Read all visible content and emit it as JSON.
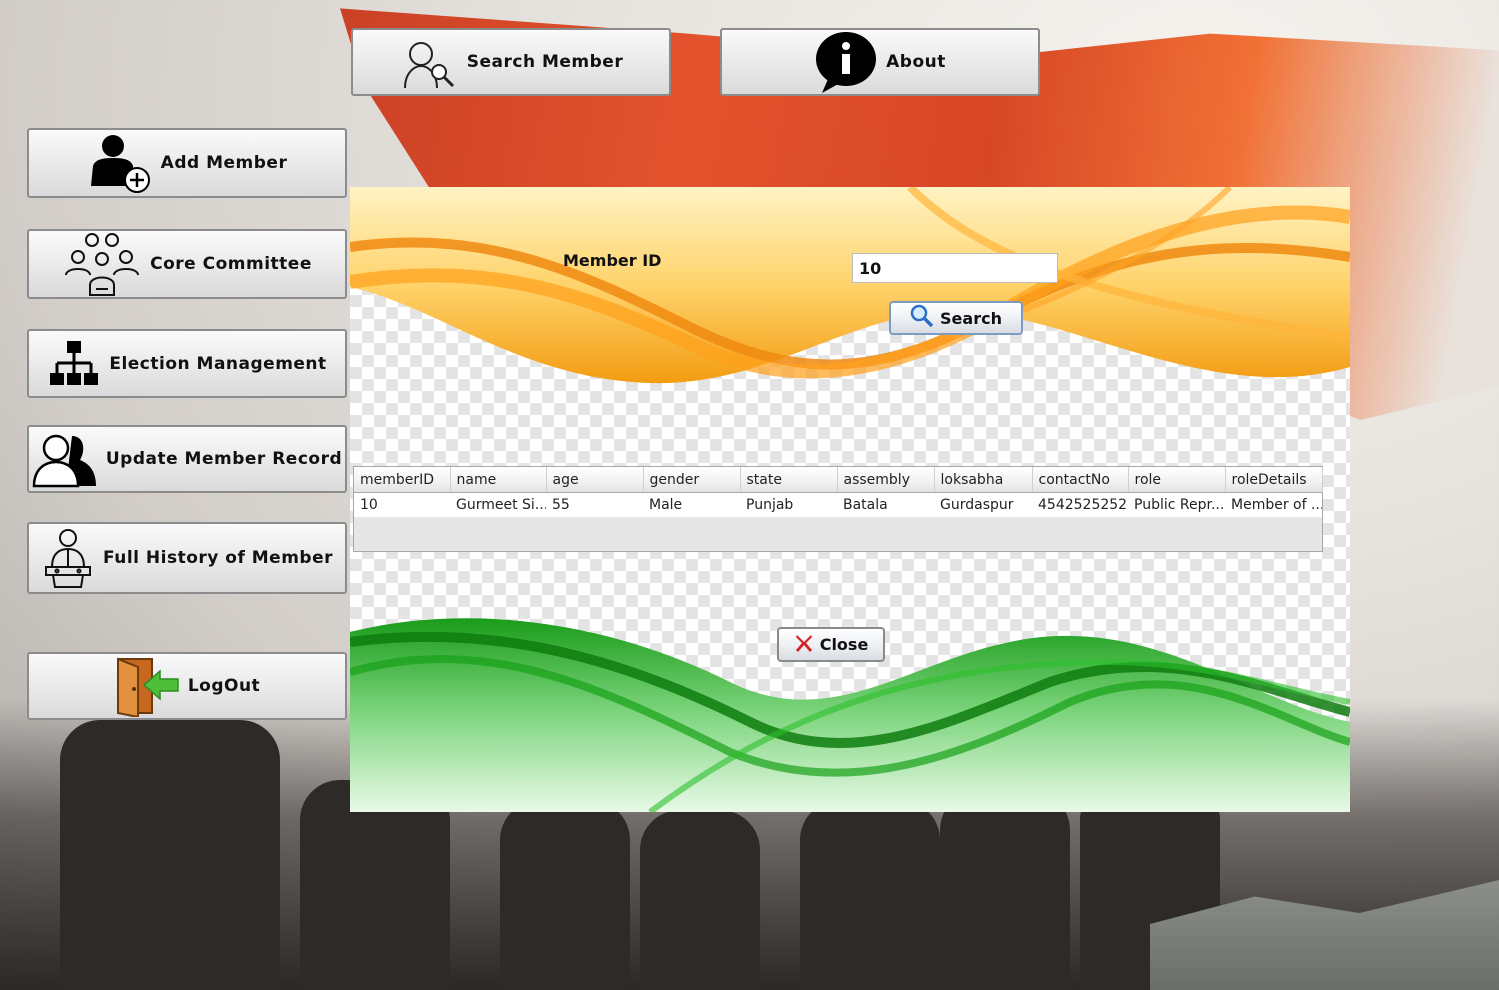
{
  "top_nav": {
    "search_member": "Search Member",
    "about": "About"
  },
  "sidebar": {
    "items": [
      {
        "label": "Add Member",
        "icon": "add-user-icon"
      },
      {
        "label": "Core Committee",
        "icon": "group-icon"
      },
      {
        "label": "Election Management",
        "icon": "hierarchy-icon"
      },
      {
        "label": "Update Member Record",
        "icon": "users-icon"
      },
      {
        "label": "Full History of Member",
        "icon": "speaker-icon"
      },
      {
        "label": "LogOut",
        "icon": "logout-door-icon"
      }
    ]
  },
  "form": {
    "member_id_label": "Member ID",
    "member_id_value": "10",
    "search_button": "Search",
    "close_button": "Close"
  },
  "table": {
    "columns": [
      "memberID",
      "name",
      "age",
      "gender",
      "state",
      "assembly",
      "loksabha",
      "contactNo",
      "role",
      "roleDetails"
    ],
    "rows": [
      [
        "10",
        "Gurmeet Si...",
        "55",
        "Male",
        "Punjab",
        "Batala",
        "Gurdaspur",
        "4542525252",
        "Public Repr...",
        "Member of ..."
      ]
    ]
  },
  "colors": {
    "saffron": "#f39c12",
    "green": "#1e9e1e",
    "button_border": "#8c8c8c"
  }
}
